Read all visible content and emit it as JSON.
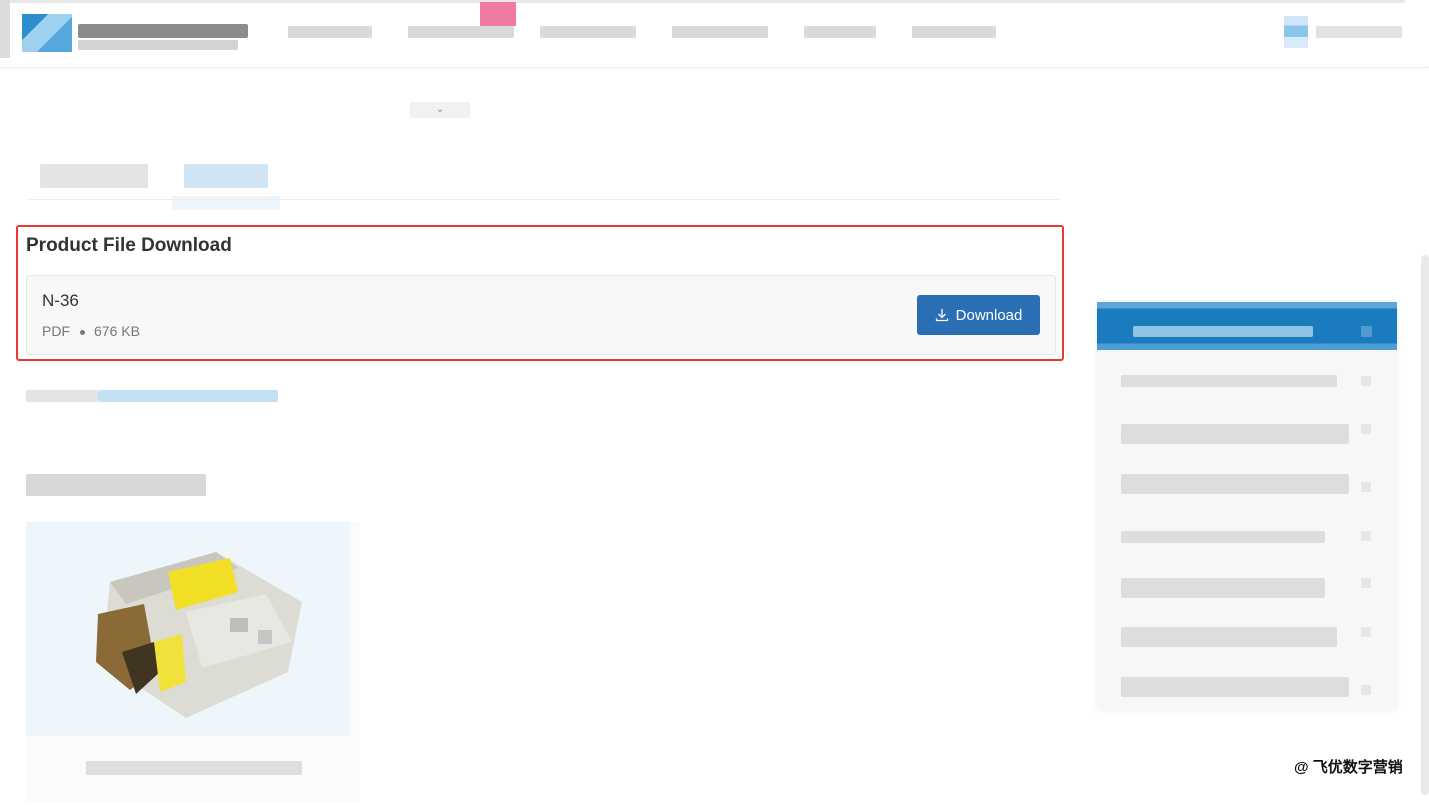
{
  "download": {
    "heading": "Product File Download",
    "file_name": "N-36",
    "file_type": "PDF",
    "file_size": "676 KB",
    "button_label": "Download",
    "button_color": "#2a6fb3",
    "highlight_color": "#e53935"
  },
  "overlay": {
    "watermark": "@ 飞优数字营销"
  }
}
